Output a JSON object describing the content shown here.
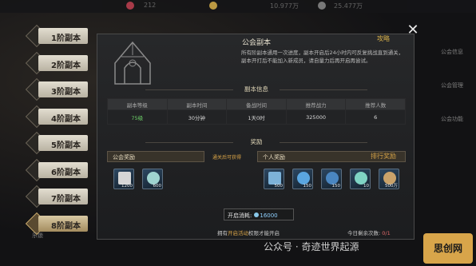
{
  "top_bar": {
    "counters": [
      "212",
      "10.977万",
      "25.477万"
    ]
  },
  "tabs": [
    {
      "label": "1阶副本",
      "active": false
    },
    {
      "label": "2阶副本",
      "active": false
    },
    {
      "label": "3阶副本",
      "active": false
    },
    {
      "label": "4阶副本",
      "active": false
    },
    {
      "label": "5阶副本",
      "active": false
    },
    {
      "label": "6阶副本",
      "active": false
    },
    {
      "label": "7阶副本",
      "active": false
    },
    {
      "label": "8阶副本",
      "active": true
    }
  ],
  "side_locked_label": "乐锁",
  "right_side": [
    "公会信息",
    "公会管理",
    "公会功能"
  ],
  "panel": {
    "title": "公会副本",
    "tag": "攻略",
    "description": "所有阶副本通用一次进度，副本开启后24小时内可反复挑战直到通关，副本开打后不能加入新成员，请自量力后再开启再尝试。",
    "info_header": "副本信息",
    "columns": [
      "副本等级",
      "副本时间",
      "备战时间",
      "推荐战力",
      "推荐人数"
    ],
    "row": [
      "75级",
      "30分钟",
      "1天0时",
      "325000",
      "6"
    ],
    "reward_header": "奖励",
    "guild_reward_label": "公会奖励",
    "personal_reward_label": "个人奖励",
    "clear_note": "通关后可获得",
    "rank_reward_link": "排行奖励",
    "guild_items": [
      {
        "icon": "scroll-icon",
        "count": "1200"
      },
      {
        "icon": "crest-icon",
        "count": "600"
      }
    ],
    "personal_items": [
      {
        "icon": "sword-icon",
        "count": "500"
      },
      {
        "icon": "orb-icon",
        "count": "150"
      },
      {
        "icon": "orb-icon",
        "count": "150"
      },
      {
        "icon": "crystal-icon",
        "count": "10"
      },
      {
        "icon": "coin-icon",
        "count": "500万"
      }
    ],
    "cost_label": "开启消耗:",
    "cost_value": "16000",
    "footer_prefix": "拥有",
    "footer_highlight": "开启活动",
    "footer_suffix": "权限才能开启",
    "remain_label": "今日剩余次数:",
    "remain_value": "0/1"
  },
  "close_label": "✕",
  "watermark": "公众号 · 奇迹世界起源",
  "watermark_logo": "思创网"
}
